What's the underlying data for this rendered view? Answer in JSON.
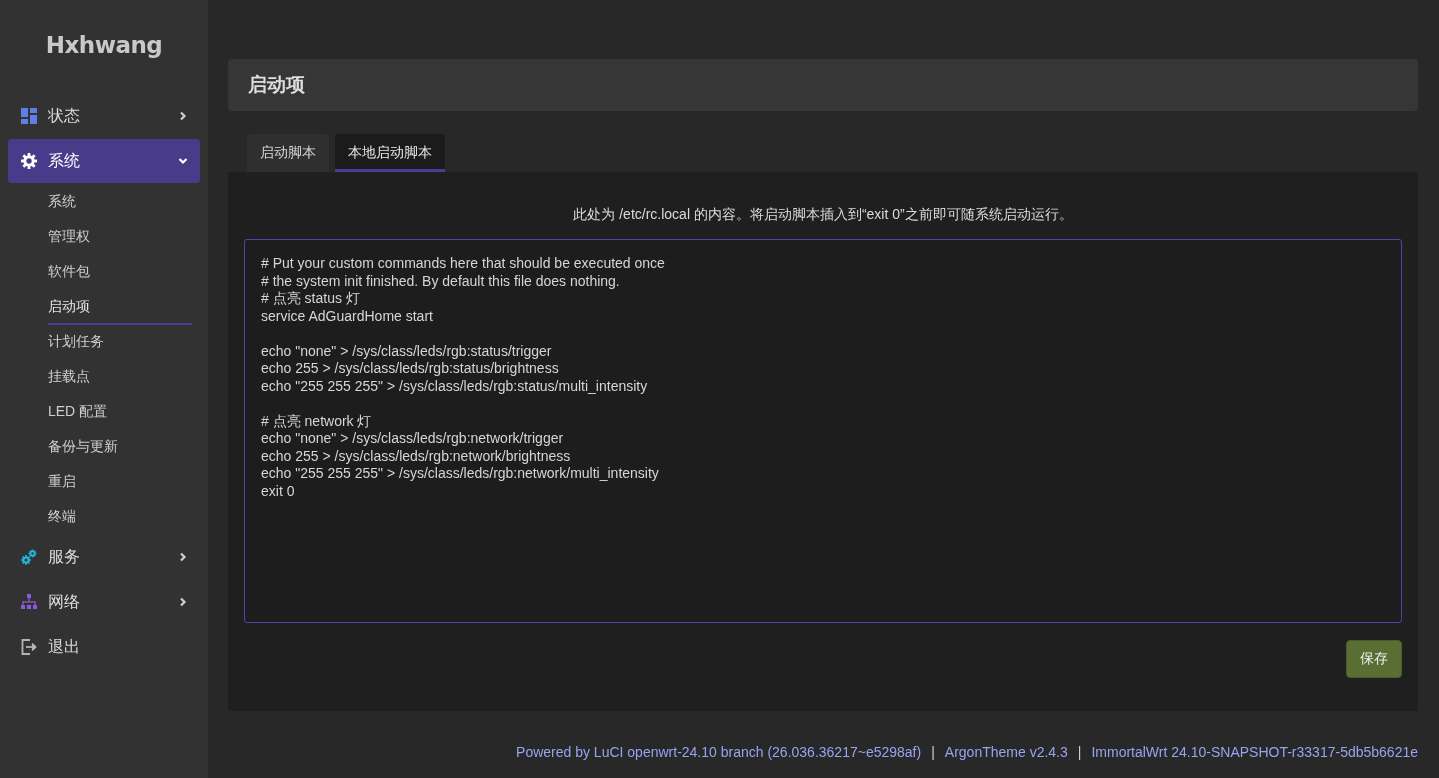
{
  "sidebar": {
    "logo": "Hxhwang",
    "menu": [
      {
        "kind": "submenu",
        "label": "状态",
        "selected": false,
        "expanded": false
      },
      {
        "kind": "submenu",
        "label": "系统",
        "selected": true,
        "expanded": true,
        "children": [
          {
            "label": "系统",
            "selected": false
          },
          {
            "label": "管理权",
            "selected": false
          },
          {
            "label": "软件包",
            "selected": false
          },
          {
            "label": "启动项",
            "selected": true
          },
          {
            "label": "计划任务",
            "selected": false
          },
          {
            "label": "挂载点",
            "selected": false
          },
          {
            "label": "LED 配置",
            "selected": false
          },
          {
            "label": "备份与更新",
            "selected": false
          },
          {
            "label": "重启",
            "selected": false
          },
          {
            "label": "终端",
            "selected": false
          }
        ]
      },
      {
        "kind": "submenu",
        "label": "服务",
        "selected": false,
        "expanded": false
      },
      {
        "kind": "submenu",
        "label": "网络",
        "selected": false,
        "expanded": false
      },
      {
        "kind": "action",
        "label": "退出",
        "selected": false
      }
    ]
  },
  "page": {
    "title": "启动项"
  },
  "tabs": [
    {
      "label": "启动脚本",
      "selected": false
    },
    {
      "label": "本地启动脚本",
      "selected": true
    }
  ],
  "panel": {
    "description": "此处为 /etc/rc.local 的内容。将启动脚本插入到“exit 0”之前即可随系统启动运行。",
    "editor": {
      "value": "# Put your custom commands here that should be executed once\n# the system init finished. By default this file does nothing.\n# 点亮 status 灯\nservice AdGuardHome start\n\necho \"none\" > /sys/class/leds/rgb:status/trigger\necho 255 > /sys/class/leds/rgb:status/brightness\necho \"255 255 255\" > /sys/class/leds/rgb:status/multi_intensity\n\n# 点亮 network 灯\necho \"none\" > /sys/class/leds/rgb:network/trigger\necho 255 > /sys/class/leds/rgb:network/brightness\necho \"255 255 255\" > /sys/class/leds/rgb:network/multi_intensity\nexit 0"
    },
    "save_button": {
      "label": "保存"
    }
  },
  "footer": [
    {
      "kind": "link",
      "text": "Powered by LuCI openwrt-24.10 branch (26.036.36217~e5298af)"
    },
    {
      "kind": "separator",
      "text": "|"
    },
    {
      "kind": "link",
      "text": "ArgonTheme v2.4.3"
    },
    {
      "kind": "separator",
      "text": "|"
    },
    {
      "kind": "link",
      "text": "ImmortalWrt 24.10-SNAPSHOT-r33317-5db5b6621e"
    }
  ]
}
